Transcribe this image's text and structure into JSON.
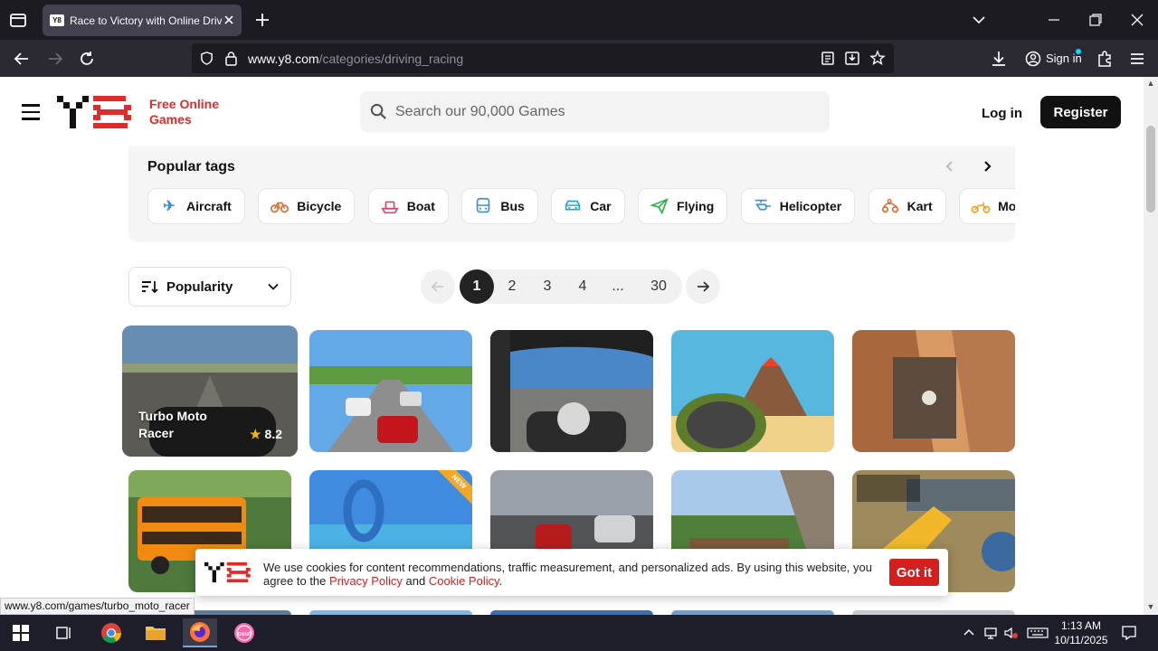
{
  "browser": {
    "tab_title": "Race to Victory with Online Driv",
    "favicon_text": "Y8",
    "url_host": "www.y8.com",
    "url_path": "/categories/driving_racing",
    "signin_label": "Sign in"
  },
  "header": {
    "logo_tagline_1": "Free Online",
    "logo_tagline_2": "Games",
    "search_placeholder": "Search our 90,000 Games",
    "login_label": "Log in",
    "register_label": "Register"
  },
  "tags": {
    "title": "Popular tags",
    "items": [
      {
        "label": "Aircraft",
        "icon": "airplane-icon",
        "color": "#3a8fd6"
      },
      {
        "label": "Bicycle",
        "icon": "bicycle-icon",
        "color": "#e0692b"
      },
      {
        "label": "Boat",
        "icon": "boat-icon",
        "color": "#e0436b"
      },
      {
        "label": "Bus",
        "icon": "bus-icon",
        "color": "#3a8fd6"
      },
      {
        "label": "Car",
        "icon": "car-icon",
        "color": "#21a7c9"
      },
      {
        "label": "Flying",
        "icon": "paper-plane-icon",
        "color": "#2fb04a"
      },
      {
        "label": "Helicopter",
        "icon": "helicopter-icon",
        "color": "#3a8fd6"
      },
      {
        "label": "Kart",
        "icon": "kart-icon",
        "color": "#e0692b"
      },
      {
        "label": "Motorcycle",
        "icon": "motorcycle-icon",
        "color": "#f0a020"
      }
    ]
  },
  "sort": {
    "label": "Popularity"
  },
  "pagination": {
    "pages": [
      "1",
      "2",
      "3",
      "4",
      "...",
      "30"
    ],
    "current": "1"
  },
  "games": [
    {
      "title": "Turbo Moto Racer",
      "rating": "8.2"
    }
  ],
  "cookie": {
    "text_1": "We use cookies for content recommendations, traffic measurement, and personalized ads. By using this website, you agree to the ",
    "privacy_link": "Privacy Policy",
    "and": " and ",
    "cookie_link": "Cookie Policy",
    "end": ".",
    "button": "Got it"
  },
  "status_url": "www.y8.com/games/turbo_moto_racer",
  "taskbar": {
    "time": "1:13 AM",
    "date": "10/11/2025"
  },
  "colors": {
    "brand_red": "#e02b2b",
    "chrome_dark": "#1c1b22",
    "button_dark": "#111111"
  }
}
